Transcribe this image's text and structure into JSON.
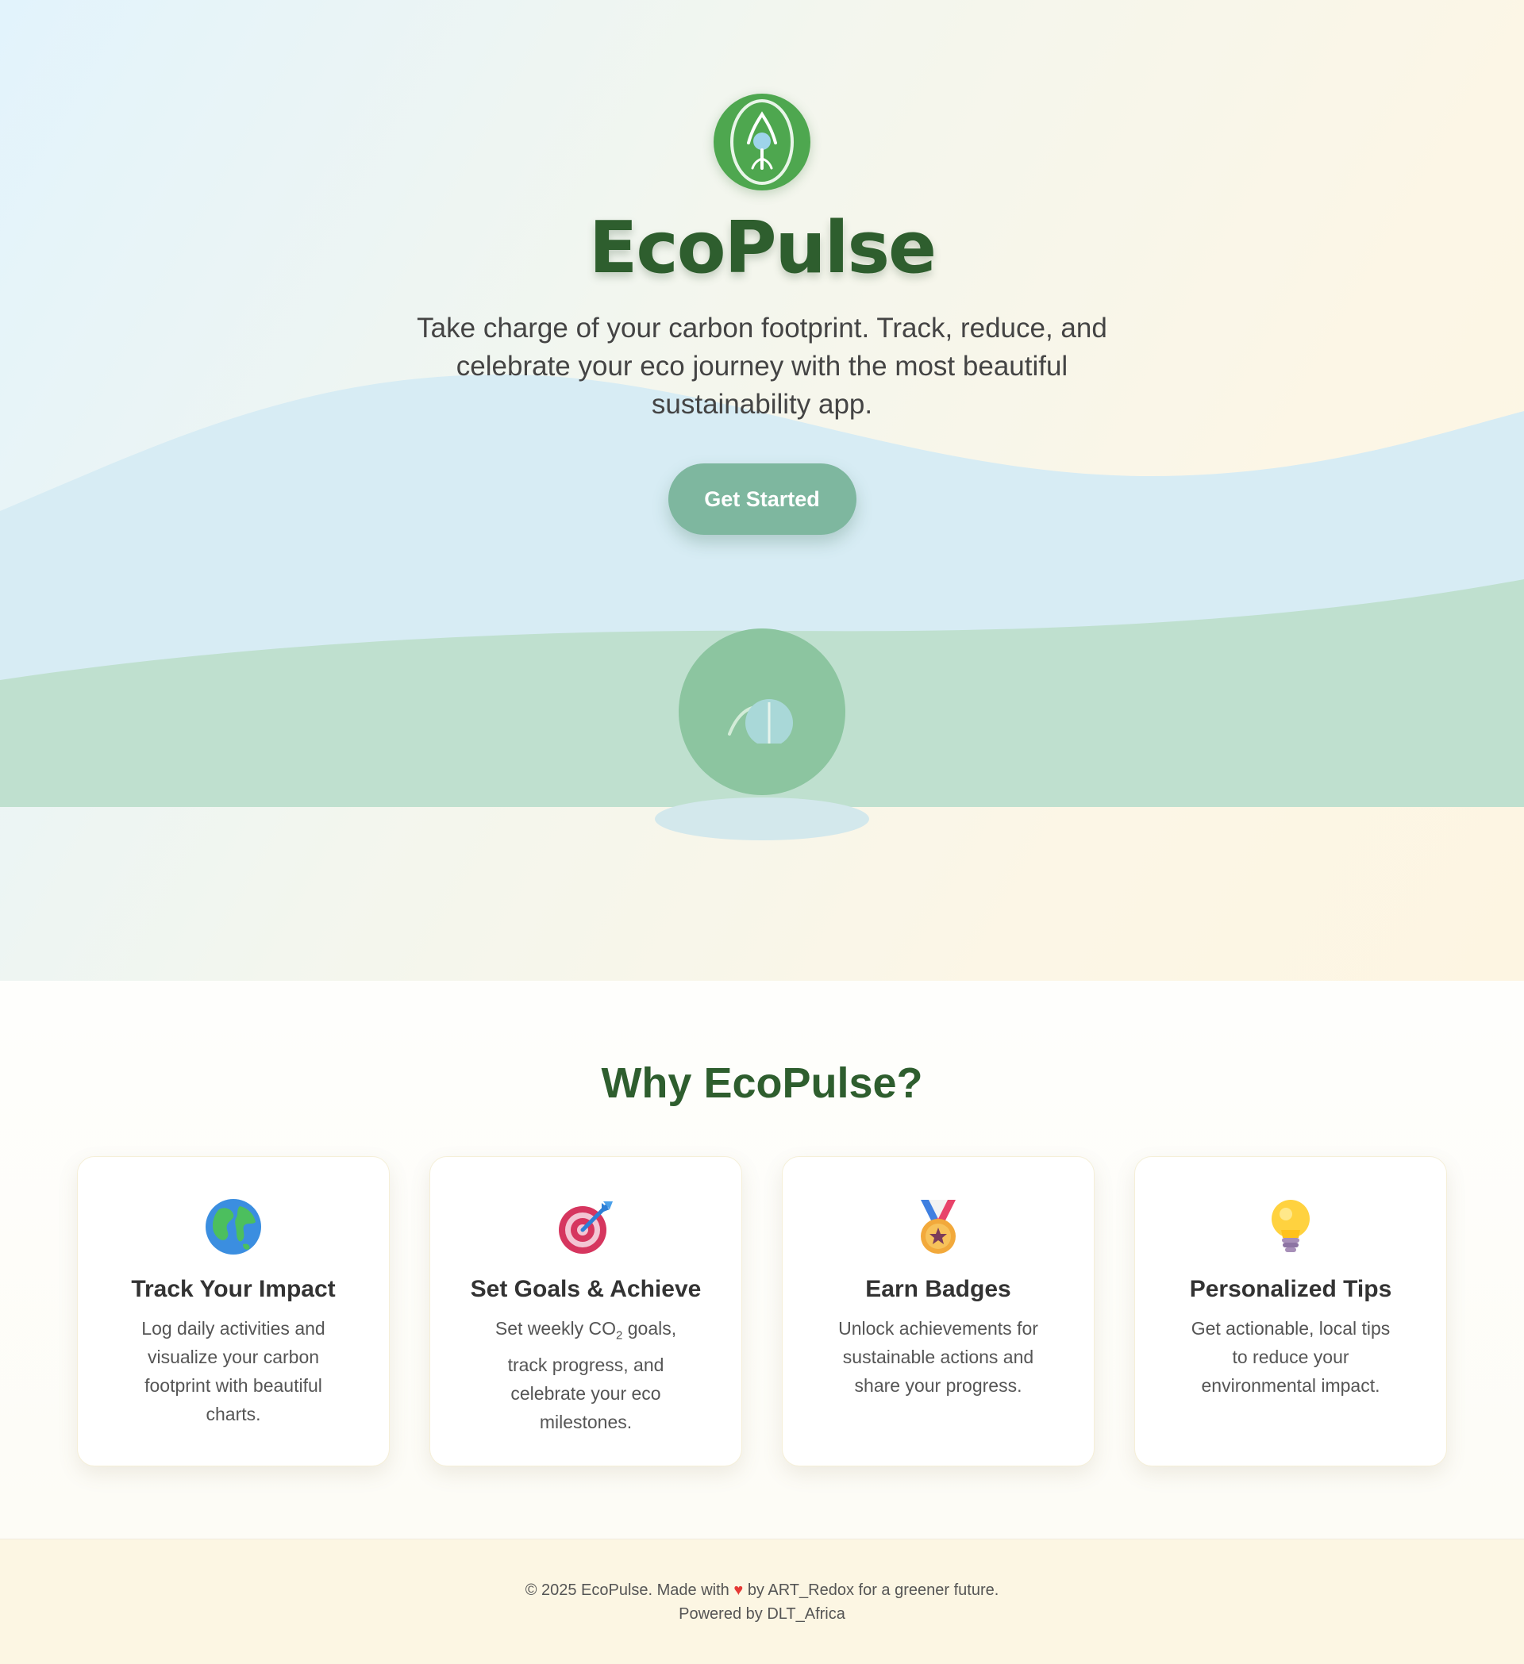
{
  "hero": {
    "logo_icon": "leaf-sprout-icon",
    "title": "EcoPulse",
    "tagline": "Take charge of your carbon footprint. Track, reduce, and celebrate your eco journey with the most beautiful sustainability app.",
    "cta_label": "Get Started",
    "illustration_icon": "earth-leaf-icon"
  },
  "features": {
    "title": "Why EcoPulse?",
    "cards": [
      {
        "icon": "globe-icon",
        "title": "Track Your Impact",
        "text": "Log daily activities and visualize your carbon footprint with beautiful charts."
      },
      {
        "icon": "target-icon",
        "title": "Set Goals & Achieve",
        "text_pre": "Set weekly CO",
        "text_sub": "2",
        "text_post": " goals, track progress, and celebrate your eco milestones."
      },
      {
        "icon": "medal-icon",
        "title": "Earn Badges",
        "text": "Unlock achievements for sustainable actions and share your progress."
      },
      {
        "icon": "lightbulb-icon",
        "title": "Personalized Tips",
        "text": "Get actionable, local tips to reduce your environmental impact."
      }
    ]
  },
  "footer": {
    "line1_pre": "© 2025 EcoPulse. Made with",
    "heart": "♥",
    "line1_post": "by ART_Redox for a greener future.",
    "line2": "Powered by DLT_Africa"
  },
  "colors": {
    "brand_green": "#2e5e2e",
    "logo_green": "#4ea74f",
    "cta_green": "#7eb79f",
    "footer_bg": "#fcf6e3"
  }
}
